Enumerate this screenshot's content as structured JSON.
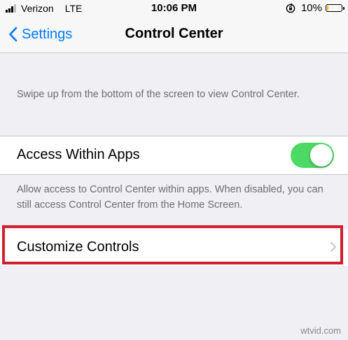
{
  "status_bar": {
    "carrier": "Verizon",
    "network": "LTE",
    "time": "10:06 PM",
    "battery_percent": "10%",
    "battery_level": 0.1,
    "battery_color": "#f2b700",
    "signal_bars_filled": 3,
    "signal_bars_total": 4,
    "rotation_lock_icon": "rotation-lock-icon"
  },
  "nav": {
    "back_label": "Settings",
    "title": "Control Center"
  },
  "settings": {
    "intro_note": "Swipe up from the bottom of the screen to view Control Center.",
    "access_within_apps": {
      "label": "Access Within Apps",
      "enabled": true,
      "toggle_color": "#4cd964"
    },
    "access_note": "Allow access to Control Center within apps. When disabled, you can still access Control Center from the Home Screen.",
    "customize_label": "Customize Controls"
  },
  "highlight_color": "#d0202e",
  "watermark": "wtvid.com"
}
